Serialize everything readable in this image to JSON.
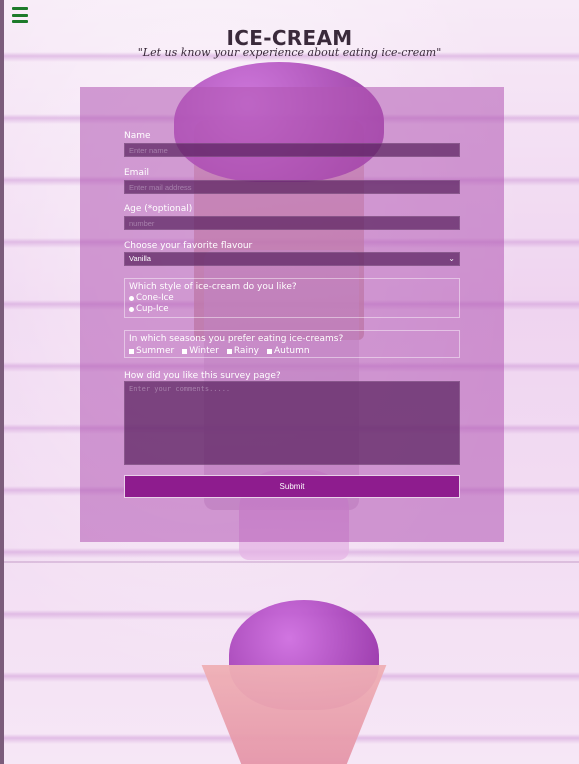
{
  "header": {
    "title": "ICE-CREAM",
    "subtitle": "\"Let us know your experience about eating ice-cream\""
  },
  "form": {
    "name": {
      "label": "Name",
      "placeholder": "Enter name"
    },
    "email": {
      "label": "Email",
      "placeholder": "Enter mail address"
    },
    "age": {
      "label": "Age (*optional)",
      "placeholder": "number"
    },
    "flavour": {
      "label": "Choose your favorite flavour",
      "selected": "Vanilla"
    },
    "style": {
      "question": "Which style of ice-cream do you like?",
      "options": [
        "Cone-Ice",
        "Cup-Ice"
      ]
    },
    "seasons": {
      "question": "In which seasons you prefer eating ice-creams?",
      "options": [
        "Summer",
        "Winter",
        "Rainy",
        "Autumn"
      ]
    },
    "comments": {
      "label": "How did you like this survey page?",
      "placeholder": "Enter your comments....."
    },
    "submit_label": "Submit"
  },
  "ui": {
    "menu_icon": "hamburger-menu-icon",
    "accent": "#8e1c8e",
    "menu_color": "#1d7a2a"
  }
}
